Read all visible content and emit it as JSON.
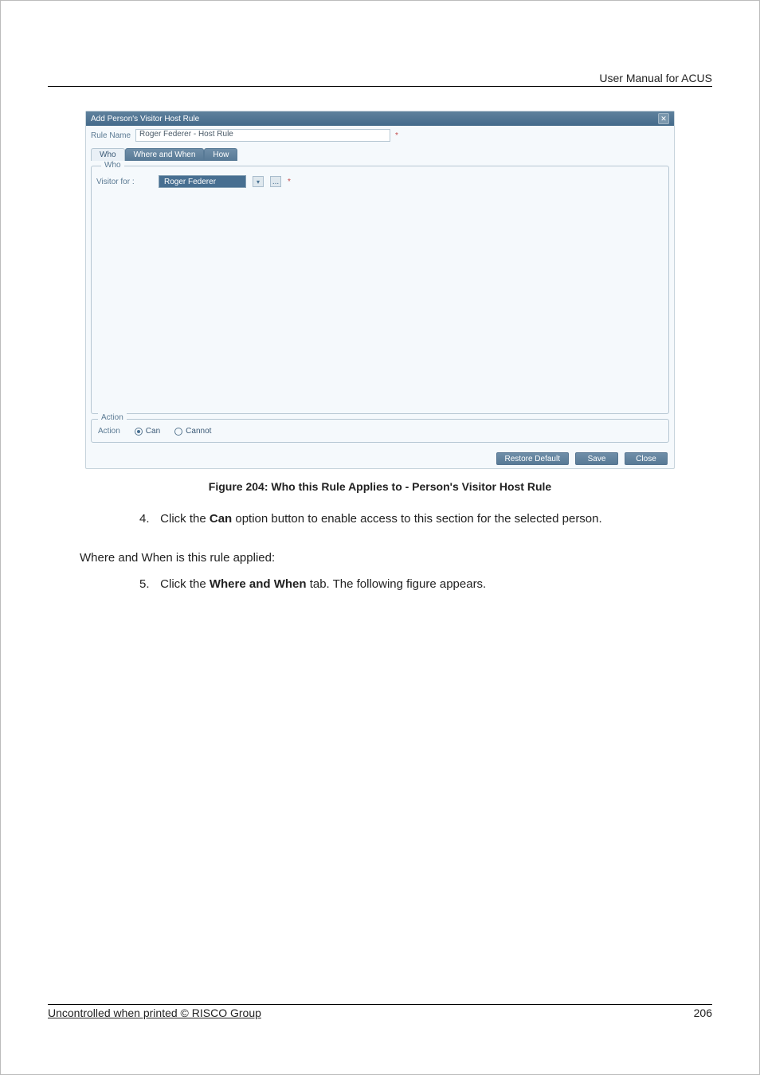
{
  "header": {
    "right_text": "User Manual for ACUS"
  },
  "screenshot": {
    "titlebar": "Add Person's Visitor Host Rule",
    "close_glyph": "✕",
    "rule_name_label": "Rule Name",
    "rule_name_value": "Roger Federer - Host Rule",
    "required_mark": "*",
    "tabs": {
      "who": "Who",
      "where_when": "Where and When",
      "how": "How"
    },
    "who_panel": {
      "legend": "Who",
      "visitor_for_label": "Visitor for :",
      "person_selected": "Roger Federer",
      "dropdown_glyph": "▾",
      "browse_glyph": "...",
      "required_mark": "*"
    },
    "action_panel": {
      "legend": "Action",
      "label": "Action",
      "can": "Can",
      "cannot": "Cannot",
      "selected": "can"
    },
    "buttons": {
      "restore": "Restore Default",
      "save": "Save",
      "close": "Close"
    }
  },
  "figure_caption": "Figure 204: Who this Rule Applies to - Person's Visitor Host Rule",
  "step4": {
    "num": "4.",
    "prefix": "Click the ",
    "bold": "Can",
    "suffix": " option button to enable access to this section for the selected person."
  },
  "section_intro": "Where and When is this rule applied:",
  "step5": {
    "num": "5.",
    "prefix": "Click the ",
    "bold": "Where and When",
    "suffix": " tab. The following figure appears."
  },
  "footer": {
    "left": "Uncontrolled when printed © RISCO Group",
    "page_no": "206"
  }
}
